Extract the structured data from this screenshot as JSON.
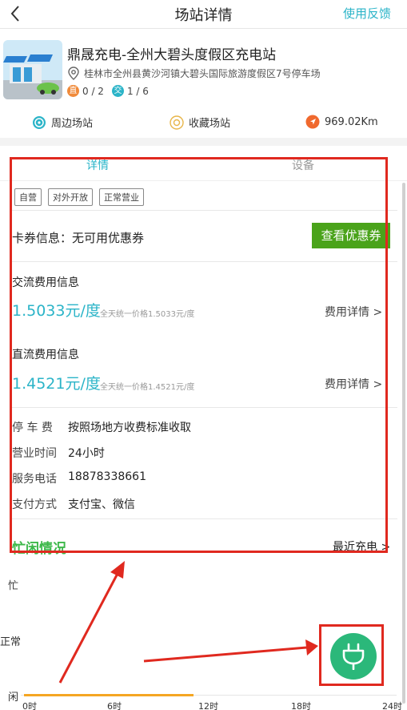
{
  "header": {
    "title": "场站详情",
    "feedback_label": "使用反馈"
  },
  "station": {
    "name": "鼎晟充电-全州大碧头度假区充电站",
    "address": "桂林市全州县黄沙河镇大碧头国际旅游度假区7号停车场",
    "dc_badge": "直",
    "dc_count": "0 / 2",
    "ac_badge": "交",
    "ac_count": "1 / 6"
  },
  "actions": {
    "nearby_label": "周边场站",
    "favorite_label": "收藏场站",
    "distance_label": "969.02Km"
  },
  "tabs": [
    {
      "label": "详情"
    },
    {
      "label": "设备"
    }
  ],
  "tags": [
    "自营",
    "对外开放",
    "正常营业"
  ],
  "coupon": {
    "label": "卡券信息：无可用优惠券",
    "button_label": "查看优惠券"
  },
  "ac_fee": {
    "title": "交流费用信息",
    "price": "1.5033元/度",
    "note": "全天统一价格1.5033元/度",
    "link_label": "费用详情 >"
  },
  "dc_fee": {
    "title": "直流费用信息",
    "price": "1.4521元/度",
    "note": "全天统一价格1.4521元/度",
    "link_label": "费用详情 >"
  },
  "info": {
    "parking_label": "停 车 费",
    "parking_value": "按照场地方收费标准收取",
    "hours_label": "营业时间",
    "hours_value": "24小时",
    "phone_label": "服务电话",
    "phone_value": "18878338661",
    "payment_label": "支付方式",
    "payment_value": "支付宝、微信"
  },
  "busy": {
    "title": "忙闲情况",
    "recent_label": "最近充电 >",
    "y_labels": [
      "忙",
      "正常",
      "闲"
    ],
    "x_labels": [
      "0时",
      "6时",
      "12时",
      "18时",
      "24时"
    ]
  },
  "colors": {
    "accent": "#2bb4c8",
    "coupon_button": "#4aa31a",
    "busy_title": "#3db84a",
    "annotation": "#e0291f",
    "fab": "#2bb87a"
  },
  "icons": {
    "back": "chevron-left-icon",
    "location": "location-pin-icon",
    "nearby": "compass-icon",
    "favorite": "star-circle-icon",
    "distance": "navigation-arrow-icon",
    "charge": "plug-icon"
  }
}
